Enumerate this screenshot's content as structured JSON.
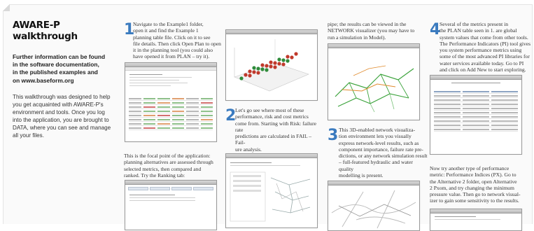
{
  "header": {
    "title": "AWARE-P walkthrough",
    "lead": "Further information can be found\nin the software documentation,\nin the published examples and\non www.baseform.org",
    "intro": "This walkthrough was designed to help\nyou get acquainted with AWARE-P's\nenvironment and tools. Once you log\ninto the application, you are brought to\nDATA, where you can see and manage\nall your files."
  },
  "steps": {
    "s1": {
      "number": "1",
      "text": "Navigate to the Example1 folder,\nopen it and find the Example 1\nplanning table file. Click on it to see\nfile details. Then click Open Plan to open\nit in the planning tool (you could also\nhave opened it from PLAN – try it)."
    },
    "s1b": {
      "text": "This is the focal point of the application:\nplanning alternatives are assessed through\nselected metrics, then compared and\nranked. Try the Ranking tab:"
    },
    "s2": {
      "number": "2",
      "text": "Let's go see where most of these\nperformance, risk and cost metrics\ncome from. Starting with Risk: failure rate\npredictions are calculated in FAIL – Fail-\nure analysis."
    },
    "s2b": {
      "text": "pipe; the results can be viewed in the\nNETWORK visualizer (you may have to\nrun a simulation in Model)."
    },
    "s3": {
      "number": "3",
      "text": "This 3D-enabled network visualiza-\ntion environment lets you visually\nexpress network-level results, such as\ncomponent importance, failure rate pre-\ndictions, or any network simulation result\n– full-featured hydraulic and water quality\nmodelling is present."
    },
    "s4": {
      "number": "4",
      "text": "Several of the metrics present in\nthe PLAN table seen in 1. are global\nsystem values that come from other tools.\nThe Performance Indicators (PI) tool gives\nyou system performance metrics using\nsome of the most advanced PI libraries for\nwater services available today. Go to PI\nand click on Add New to start exploring."
    },
    "s4b": {
      "text": "Now try another type of performance\nmetric: Performance Indices (PX). Go to\nthe Alternative 2 folder, open Alternative\n2 Pxom, and try changing the minimum\npressure value. Then go to network visual-\nizer to gain some sensitivity to the results."
    }
  },
  "colors": {
    "accent": "#3b7bbf",
    "dot_red": "#c0392b",
    "dot_green": "#2e8b3a",
    "net_green": "#3aa23a",
    "net_orange": "#e08a2c"
  },
  "icons": [
    "step-number-badge",
    "window-screenshot"
  ]
}
